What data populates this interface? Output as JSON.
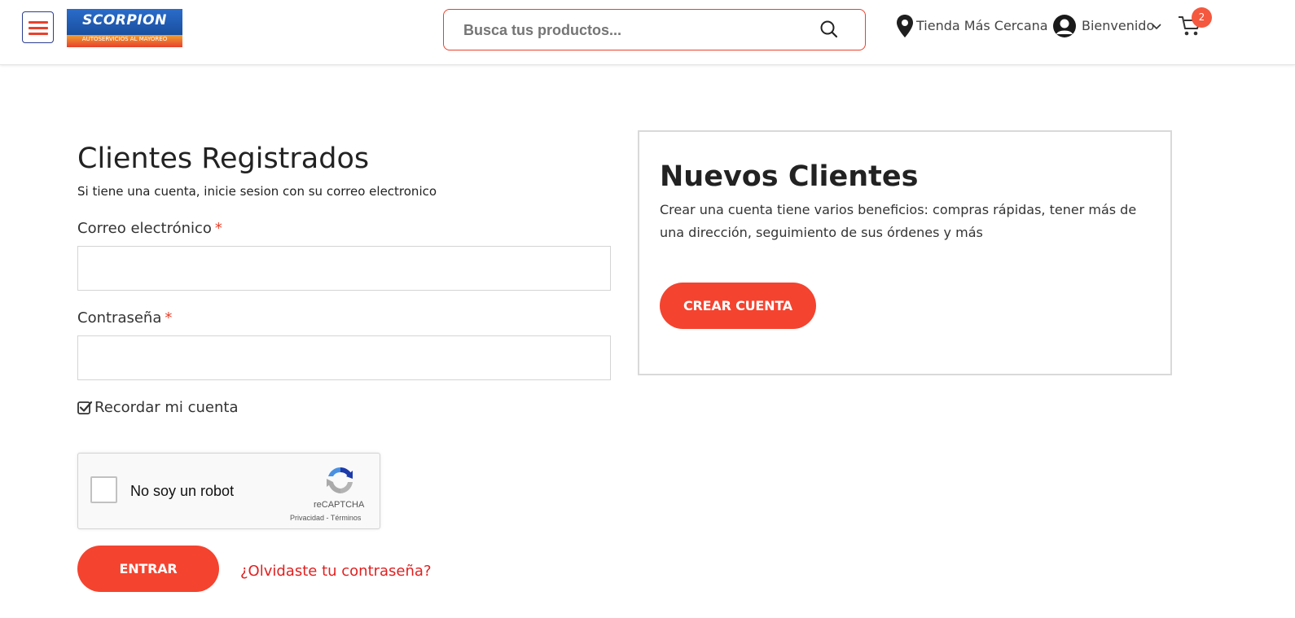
{
  "header": {
    "logo_text": "SCORPION",
    "logo_subtext": "AUTOSERVICIOS AL MAYOREO",
    "search_placeholder": "Busca tus productos...",
    "store_label": "Tienda Más Cercana",
    "welcome_label": "Bienvenido",
    "cart_count": "2",
    "icons": [
      "menu-icon",
      "search-icon",
      "map-pin-icon",
      "user-avatar-icon",
      "chevron-down-icon",
      "cart-icon"
    ],
    "accent_color": "#f4432f"
  },
  "login": {
    "title": "Clientes Registrados",
    "subtitle": "Si tiene una cuenta, inicie sesion con su correo electronico",
    "email_label": "Correo electrónico",
    "email_value": "",
    "password_label": "Contraseña",
    "password_value": "",
    "required_mark": "*",
    "remember_label": "Recordar mi cuenta",
    "remember_checked": true,
    "captcha": {
      "label": "No soy un robot",
      "brand": "reCAPTCHA",
      "links": "Privacidad - Términos"
    },
    "submit_label": "ENTRAR",
    "forgot_label": "¿Olvidaste tu contraseña?"
  },
  "new_customers": {
    "title": "Nuevos Clientes",
    "description": "Crear una cuenta tiene varios beneficios: compras rápidas, tener más de una dirección, seguimiento de sus órdenes y más",
    "button_label": "CREAR CUENTA"
  }
}
